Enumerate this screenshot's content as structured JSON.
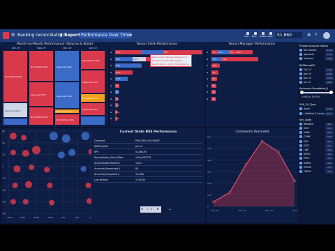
{
  "app": {
    "title": "Banking reconciliation",
    "breadcrumb_section": "Report",
    "report_title": "Performance Over Time",
    "toolbar_buttons": [
      "Undo",
      "Redo",
      "Publish",
      "Share"
    ],
    "search_value": "51,860",
    "colors": {
      "accent": "#e0394a",
      "header": "#1e3d7a",
      "panel": "#0e1d44"
    }
  },
  "mom_panel": {
    "title": "Month-on-Month Performance (Volume & State)",
    "columns": [
      "Oct 19",
      "Nov 19",
      "Dec 19",
      "Jan 19"
    ],
    "stacks": [
      [
        {
          "label": "Not Started 69%",
          "pct": 69,
          "c": "#d9394b"
        },
        {
          "label": "Approved 21%",
          "pct": 21,
          "c": "#cfd6e8"
        },
        {
          "label": "",
          "pct": 10,
          "c": "#3a6bc8"
        }
      ],
      [
        {
          "label": "Not Started 42%",
          "pct": 42,
          "c": "#d9394b"
        },
        {
          "label": "Approved 33%",
          "pct": 33,
          "c": "#d9394b"
        },
        {
          "label": "Not Started 25%",
          "pct": 25,
          "c": "#d9394b"
        }
      ],
      [
        {
          "label": "Approved 42%",
          "pct": 42,
          "c": "#3a6bc8"
        },
        {
          "label": "Approved 36%",
          "pct": 36,
          "c": "#3a6bc8"
        },
        {
          "label": "Unmatched 6%",
          "pct": 6,
          "c": "#f2a01c"
        },
        {
          "label": "Not Started 16%",
          "pct": 16,
          "c": "#d9394b"
        }
      ],
      [
        {
          "label": "Not Started 26%",
          "pct": 26,
          "c": "#d9394b"
        },
        {
          "label": "Approved 31%",
          "pct": 31,
          "c": "#d9394b"
        },
        {
          "label": "Cancelled 12%",
          "pct": 12,
          "c": "#f2a01c"
        },
        {
          "label": "Approved 18%",
          "pct": 18,
          "c": "#d9394b"
        },
        {
          "label": "",
          "pct": 13,
          "c": "#3a6bc8"
        }
      ]
    ]
  },
  "clerk_panel": {
    "title": "Recon Clerk Performance",
    "bars": [
      [
        {
          "v": 30,
          "c": "#d9394b",
          "t": "31%"
        },
        {
          "v": 25,
          "c": "#3a6bc8",
          "t": ""
        },
        {
          "v": 45,
          "c": "#d9394b",
          "t": "54%"
        }
      ],
      [
        {
          "v": 20,
          "c": "#3a6bc8",
          "t": "20%"
        },
        {
          "v": 15,
          "c": "#cfd6e8",
          "t": "18%"
        },
        {
          "v": 35,
          "c": "#d9394b",
          "t": ""
        }
      ],
      [
        {
          "v": 30,
          "c": "#3a6bc8",
          "t": "33%"
        }
      ],
      [
        {
          "v": 20,
          "c": "#d9394b",
          "t": "21%"
        }
      ],
      [
        {
          "v": 14,
          "c": "#3a6bc8",
          "t": "14%"
        }
      ],
      [
        {
          "v": 5,
          "c": "#d9394b",
          "t": "6%"
        }
      ],
      [
        {
          "v": 4,
          "c": "#3a6bc8",
          "t": "5%"
        }
      ],
      [
        {
          "v": 3,
          "c": "#d9394b",
          "t": "3%"
        }
      ],
      [
        {
          "v": 3,
          "c": "#d9394b",
          "t": "3%"
        }
      ],
      [
        {
          "v": 2,
          "c": "#d9394b",
          "t": "2%"
        }
      ],
      [
        {
          "v": 2,
          "c": "#d9394b",
          "t": "2%"
        }
      ]
    ],
    "tooltip": [
      "Recon Clerk: Mungan Robinson #",
      "Private Account: Not Started",
      "Reconciliation: 0.2 in 78 Remaining"
    ]
  },
  "manager_panel": {
    "title": "Recon Manager Performance",
    "bars": [
      [
        {
          "v": 7,
          "c": "#d9394b",
          "t": "7%"
        },
        {
          "v": 14,
          "c": "#3a6bc8",
          "t": "16%"
        },
        {
          "v": 8,
          "c": "#d9394b",
          "t": "8%"
        },
        {
          "v": 20,
          "c": "#d9394b",
          "t": "54%"
        }
      ],
      [
        {
          "v": 12,
          "c": "#3a6bc8",
          "t": "13%"
        },
        {
          "v": 44,
          "c": "#d9394b",
          "t": "54%"
        }
      ],
      [
        {
          "v": 10,
          "c": "#d9394b",
          "t": "13%"
        }
      ],
      [
        {
          "v": 8,
          "c": "#d9394b",
          "t": "7%"
        }
      ],
      [
        {
          "v": 7,
          "c": "#d9394b",
          "t": "5%"
        }
      ],
      [
        {
          "v": 6,
          "c": "#d9394b",
          "t": "5%"
        }
      ],
      [
        {
          "v": 5,
          "c": "#d9394b",
          "t": "5%"
        }
      ],
      [
        {
          "v": 5,
          "c": "#d9394b",
          "t": "4%"
        }
      ]
    ]
  },
  "bubble_panel": {
    "y_ticks": [
      "60",
      "40",
      "20",
      "0",
      "-20",
      "-40",
      "-60",
      "-80"
    ],
    "x_ticks": [
      "-3900",
      "5000",
      "5884",
      "1000",
      "500",
      "300",
      "1000",
      "2000"
    ],
    "bubbles": [
      {
        "x": 0.05,
        "y": 0.06,
        "r": 5,
        "c": "#d9394b"
      },
      {
        "x": 0.16,
        "y": 0.08,
        "r": 4,
        "c": "#d9394b"
      },
      {
        "x": 0.47,
        "y": 0.06,
        "r": 6,
        "c": "#3a6bc8"
      },
      {
        "x": 0.6,
        "y": 0.09,
        "r": 6,
        "c": "#3a6bc8"
      },
      {
        "x": 0.8,
        "y": 0.06,
        "r": 6,
        "c": "#3a6bc8"
      },
      {
        "x": 0.95,
        "y": 0.07,
        "r": 4,
        "c": "#d9394b"
      },
      {
        "x": 0.05,
        "y": 0.26,
        "r": 4,
        "c": "#d9394b"
      },
      {
        "x": 0.18,
        "y": 0.27,
        "r": 5,
        "c": "#d9394b"
      },
      {
        "x": 0.29,
        "y": 0.23,
        "r": 6,
        "c": "#d9394b"
      },
      {
        "x": 0.55,
        "y": 0.29,
        "r": 5,
        "c": "#3a6bc8"
      },
      {
        "x": 0.66,
        "y": 0.26,
        "r": 5,
        "c": "#3a6bc8"
      },
      {
        "x": 0.86,
        "y": 0.25,
        "r": 4,
        "c": "#d9394b"
      },
      {
        "x": 0.09,
        "y": 0.46,
        "r": 5,
        "c": "#d9394b"
      },
      {
        "x": 0.24,
        "y": 0.44,
        "r": 4,
        "c": "#d9394b"
      },
      {
        "x": 0.4,
        "y": 0.47,
        "r": 4,
        "c": "#d9394b"
      },
      {
        "x": 0.78,
        "y": 0.46,
        "r": 4,
        "c": "#3a6bc8"
      },
      {
        "x": 0.07,
        "y": 0.66,
        "r": 4,
        "c": "#d9394b"
      },
      {
        "x": 0.21,
        "y": 0.65,
        "r": 5,
        "c": "#d9394b"
      },
      {
        "x": 0.43,
        "y": 0.66,
        "r": 4,
        "c": "#d9394b"
      },
      {
        "x": 0.83,
        "y": 0.66,
        "r": 4,
        "c": "#d9394b"
      },
      {
        "x": 0.96,
        "y": 0.63,
        "r": 4,
        "c": "#3a6bc8"
      },
      {
        "x": 0.05,
        "y": 0.86,
        "r": 4,
        "c": "#d9394b"
      },
      {
        "x": 0.18,
        "y": 0.86,
        "r": 4,
        "c": "#d9394b"
      },
      {
        "x": 0.45,
        "y": 0.87,
        "r": 4,
        "c": "#d9394b"
      },
      {
        "x": 0.84,
        "y": 0.85,
        "r": 4,
        "c": "#d9394b"
      },
      {
        "x": 0.95,
        "y": 0.86,
        "r": 5,
        "c": "#d9394b"
      }
    ]
  },
  "state_panel": {
    "title": "Current State BSS Performance",
    "rows": [
      {
        "k": "Comment",
        "v": "PROCEED DOCUMENT"
      },
      {
        "k": "BSSPeriodID",
        "v": "Jan 19"
      },
      {
        "k": "RPS",
        "v": "51,864.95"
      },
      {
        "k": "Reconciliation_Row_Offset",
        "v": "1 Day RECTID"
      },
      {
        "k": "Accounts/Not Started Ji",
        "v": "1,831"
      },
      {
        "k": "Accounts/Unmatched Ji",
        "v": "80"
      },
      {
        "k": "Accounts/Completed Ji",
        "v": "10,38%"
      },
      {
        "k": "Last Refresh",
        "v": "12:08:39"
      }
    ],
    "pager": "1 - 6"
  },
  "comments_panel": {
    "title": "Comments Recorded",
    "x_ticks": [
      "Oct 19",
      "Nov 19",
      "Dec 19",
      "Jan 19"
    ],
    "y_ticks": [
      "600",
      "500",
      "400",
      "300",
      "200",
      "100",
      "0"
    ],
    "points": [
      {
        "x": "Oct 19",
        "y": 40
      },
      {
        "x": "Nov 19",
        "y": 120
      },
      {
        "x": "Dec 19",
        "y": 360
      },
      {
        "x": "Dec 19b",
        "y": 560
      },
      {
        "x": "Jan 19a",
        "y": 470
      },
      {
        "x": "Jan 19",
        "y": 220
      }
    ]
  },
  "filters": {
    "groups": [
      {
        "title": "Private Account Status",
        "items": [
          {
            "label": "Not Started",
            "count": "4128"
          },
          {
            "label": "Approved",
            "count": "3311"
          },
          {
            "label": "Matched",
            "count": "2988"
          }
        ]
      },
      {
        "title": "BSSPeriodID",
        "items": [
          {
            "label": "Oct 19",
            "count": "2491"
          },
          {
            "label": "Nov 19",
            "count": "2384"
          },
          {
            "label": "Dec 19",
            "count": "2078"
          },
          {
            "label": "Jan 19",
            "count": "1862"
          }
        ]
      },
      {
        "title": "Accounts Completed_JI",
        "items": []
      },
      {
        "title": "SAP_GL_Type",
        "items": [
          {
            "label": "Asset",
            "count": "4180"
          },
          {
            "label": "Liabilities & Equity",
            "count": "3977"
          }
        ]
      },
      {
        "title": "Set_Code",
        "items": [
          {
            "label": "BINANCE",
            "count": "801"
          },
          {
            "label": "SOLT",
            "count": "672"
          },
          {
            "label": "UNKU",
            "count": "592"
          },
          {
            "label": "COMIC",
            "count": "545"
          },
          {
            "label": "EUR",
            "count": "471"
          },
          {
            "label": "EXCP",
            "count": "411"
          },
          {
            "label": "LINE",
            "count": "398"
          },
          {
            "label": "NITRO",
            "count": "354"
          },
          {
            "label": "PROF",
            "count": "310"
          },
          {
            "label": "SIGMA",
            "count": "288"
          },
          {
            "label": "STEMS",
            "count": "251"
          },
          {
            "label": "TRADE",
            "count": "210"
          }
        ]
      }
    ],
    "slider_text": "0.9% to 35.65%"
  }
}
